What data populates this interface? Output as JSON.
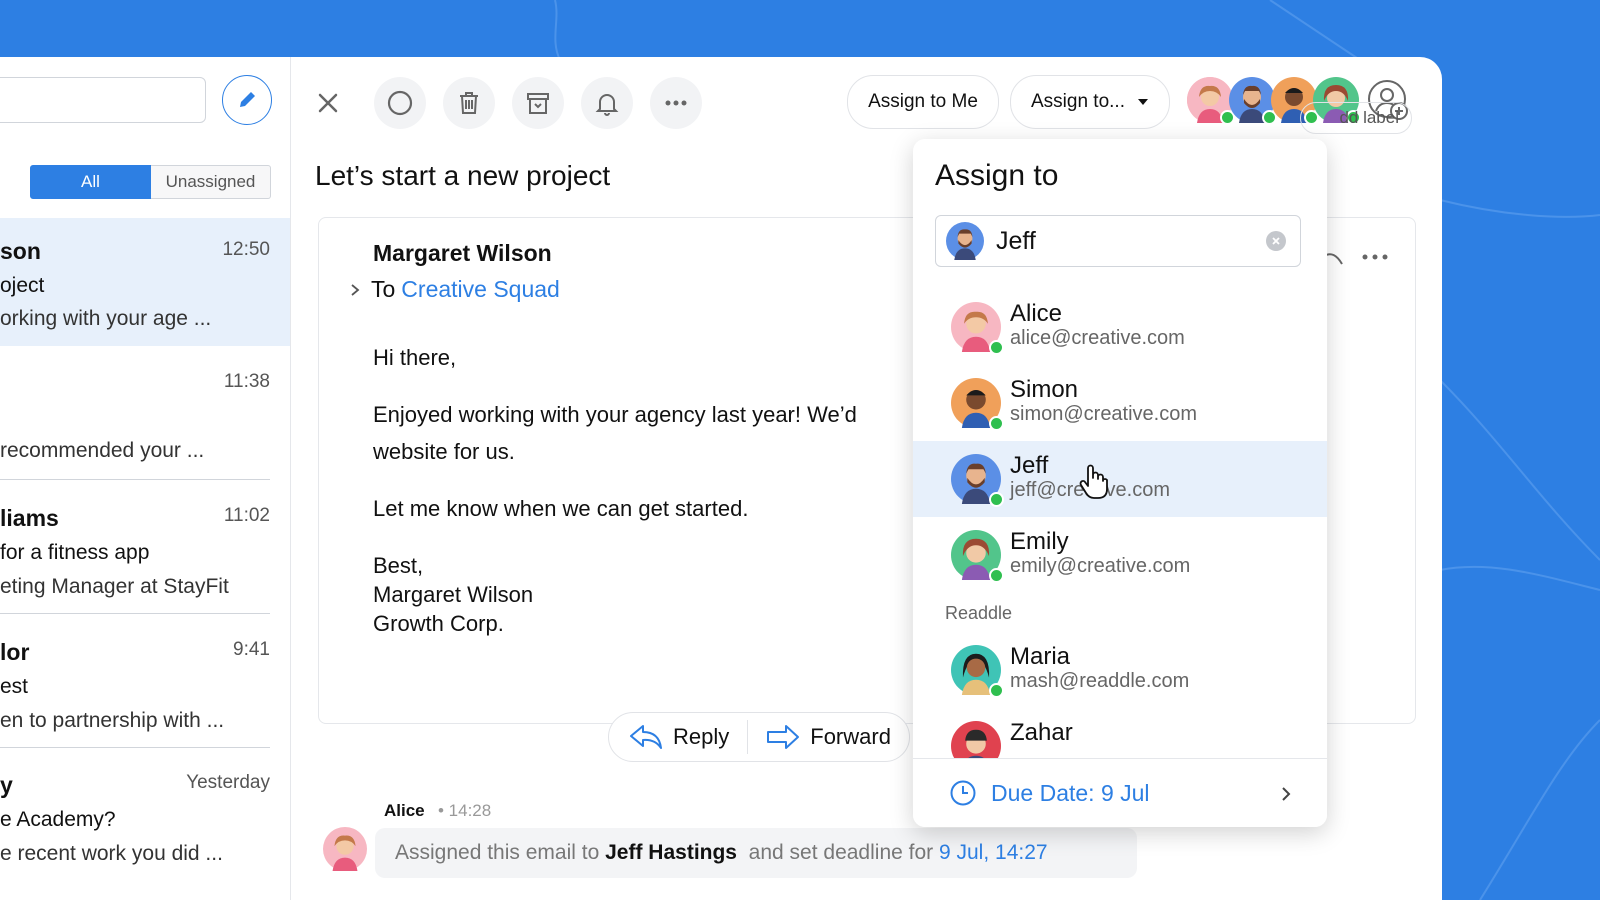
{
  "colors": {
    "accent": "#2d7fe3",
    "background": "#2d7fe3",
    "online": "#2fbf4f"
  },
  "sidebar": {
    "filter_all": "All",
    "filter_unassigned": "Unassigned",
    "messages": [
      {
        "sender": "son",
        "time": "12:50",
        "subject": "oject",
        "preview": "orking with your age ..."
      },
      {
        "sender": "",
        "time": "11:38",
        "subject": "",
        "preview": "recommended your ..."
      },
      {
        "sender": "liams",
        "time": "11:02",
        "subject": "for a fitness app",
        "preview": "eting Manager at StayFit"
      },
      {
        "sender": "lor",
        "time": "9:41",
        "subject": "est",
        "preview": "en to partnership with ..."
      },
      {
        "sender": "y",
        "time": "Yesterday",
        "subject": "e Academy?",
        "preview": "e recent work you did ..."
      }
    ]
  },
  "toolbar": {
    "assign_to_me": "Assign to Me",
    "assign_to": "Assign to..."
  },
  "email": {
    "subject": "Let’s start a new project",
    "add_label": "dd label",
    "sender": "Margaret Wilson",
    "to_prefix": "To",
    "to_group": "Creative Squad",
    "greeting": "Hi there,",
    "line1": "Enjoyed working with your agency last year! We’d",
    "line2": "website for us.",
    "line3": "Let me know when we can get started.",
    "sign1": "Best,",
    "sign2": "Margaret Wilson",
    "sign3": "Growth Corp.",
    "reply": "Reply",
    "forward": "Forward"
  },
  "activity": {
    "name": "Alice",
    "time": "• 14:28",
    "text_prefix": "Assigned this email to",
    "assignee": "Jeff Hastings",
    "text_mid": "and set deadline for",
    "deadline": "9 Jul, 14:27"
  },
  "dropdown": {
    "title": "Assign to",
    "search_value": "Jeff",
    "group_label": "Readdle",
    "people": [
      {
        "name": "Alice",
        "email": "alice@creative.com",
        "highlighted": false,
        "online": true
      },
      {
        "name": "Simon",
        "email": "simon@creative.com",
        "highlighted": false,
        "online": true
      },
      {
        "name": "Jeff",
        "email": "jeff@creative.com",
        "highlighted": true,
        "online": true
      },
      {
        "name": "Emily",
        "email": "emily@creative.com",
        "highlighted": false,
        "online": true
      },
      {
        "name": "Maria",
        "email": "mash@readdle.com",
        "highlighted": false,
        "online": true
      },
      {
        "name": "Zahar",
        "email": "",
        "highlighted": false,
        "online": false
      }
    ],
    "due_date": "Due Date: 9 Jul"
  }
}
